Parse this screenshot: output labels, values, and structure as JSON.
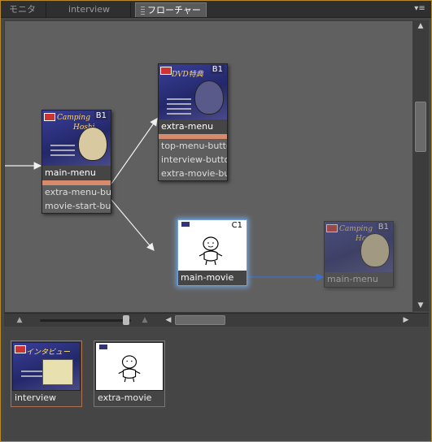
{
  "tabs": [
    {
      "label": "モニタ"
    },
    {
      "label": "interview"
    },
    {
      "label": "フローチャート"
    }
  ],
  "close_glyph": "×",
  "panel_menu_glyph": "▾≡",
  "icons": {
    "zoom_out": "▲",
    "zoom_in": "▲",
    "scroll_up": "▲",
    "scroll_down": "▼",
    "scroll_left": "◀",
    "scroll_right": "▶"
  },
  "colors": {
    "accent_border": "#b88a2a",
    "selection_glow": "#6ea2d8",
    "link_blue": "#3a6fd0",
    "separator": "#d88a6c"
  },
  "nodes": {
    "main_menu": {
      "title": "main-menu",
      "badge": "B1",
      "buttons": [
        "extra-menu-but",
        "movie-start-bu"
      ]
    },
    "extra_menu": {
      "title": "extra-menu",
      "badge": "B1",
      "buttons": [
        "top-menu-butto",
        "interview-butto",
        "extra-movie-bu"
      ]
    },
    "main_movie": {
      "title": "main-movie",
      "badge": "C1"
    },
    "main_menu_ghost": {
      "title": "main-menu",
      "badge": "B1"
    }
  },
  "tray": [
    {
      "label": "interview"
    },
    {
      "label": "extra-movie"
    }
  ],
  "zoom_level": 0.82
}
